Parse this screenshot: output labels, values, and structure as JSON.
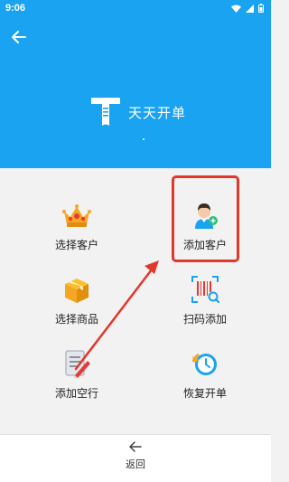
{
  "status_bar": {
    "time": "9:06"
  },
  "header": {
    "title": "天天开单"
  },
  "menu": {
    "select_customer": "选择客户",
    "add_customer": "添加客户",
    "select_product": "选择商品",
    "scan_add": "扫码添加",
    "add_empty_row": "添加空行",
    "restore_order": "恢复开单"
  },
  "bottom": {
    "back_label": "返回"
  },
  "colors": {
    "header": "#1aa3f0",
    "highlight": "#e0382b",
    "background": "#f2f2f2"
  },
  "icons": [
    "back-arrow-icon",
    "crown-icon",
    "person-add-icon",
    "box-icon",
    "barcode-scan-icon",
    "edit-note-icon",
    "clock-restore-icon"
  ]
}
